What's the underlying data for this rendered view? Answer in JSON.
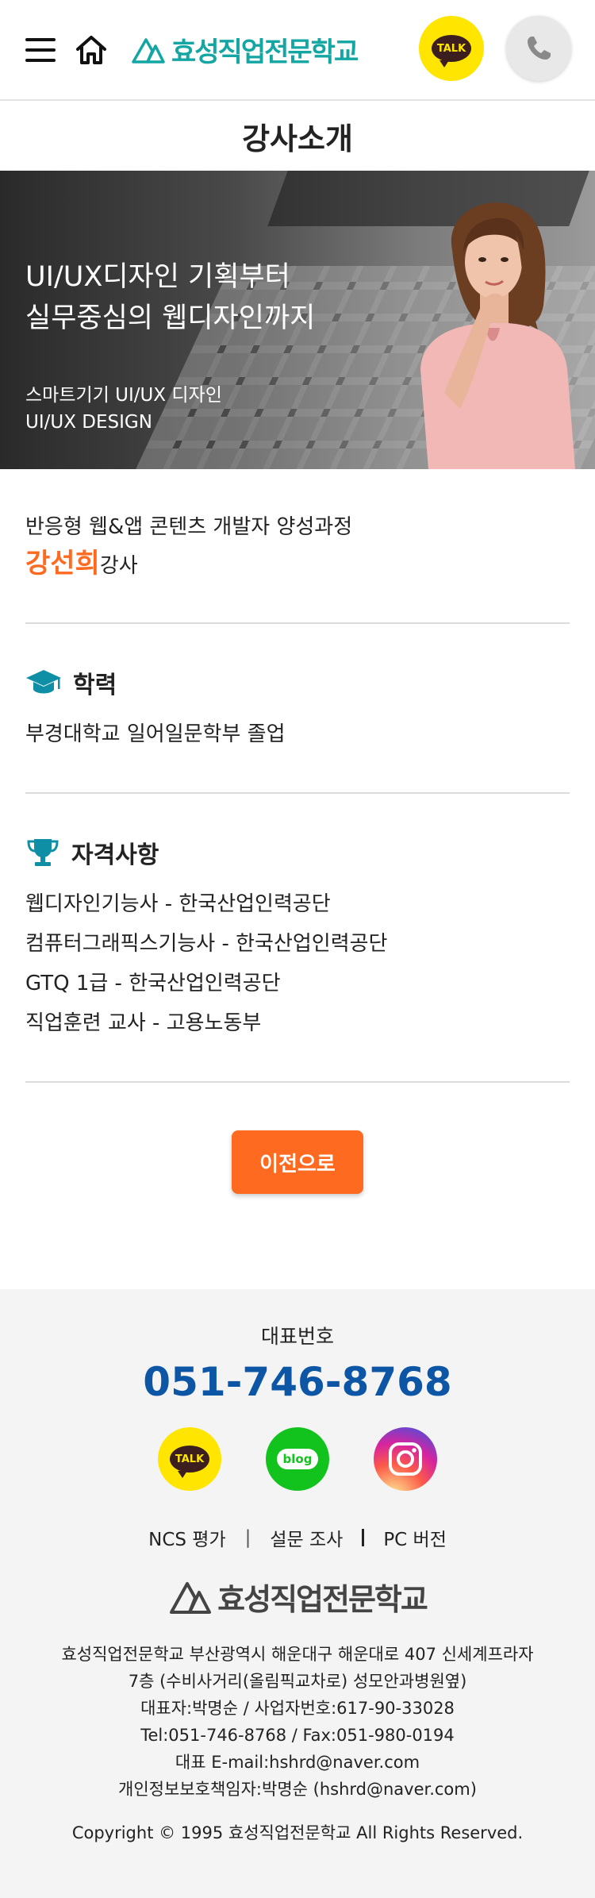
{
  "header": {
    "menu_icon": "hamburger-icon",
    "home_icon": "home-icon",
    "logo_text": "효성직업전문학교",
    "talk_label": "TALK",
    "phone_icon": "phone-icon"
  },
  "page_title": "강사소개",
  "hero": {
    "headline_line1": "UI/UX디자인 기획부터",
    "headline_line2": "실무중심의 웹디자인까지",
    "sub_line1": "스마트기기 UI/UX 디자인",
    "sub_line2": "UI/UX DESIGN"
  },
  "intro": {
    "course": "반응형 웹&앱 콘텐츠 개발자 양성과정",
    "name": "강선희",
    "title": "강사"
  },
  "education": {
    "title": "학력",
    "icon": "graduation-cap-icon",
    "items": [
      "부경대학교 일어일문학부 졸업"
    ]
  },
  "certifications": {
    "title": "자격사항",
    "icon": "trophy-icon",
    "items": [
      "웹디자인기능사 - 한국산업인력공단",
      "컴퓨터그래픽스기능사 - 한국산업인력공단",
      "GTQ 1급 - 한국산업인력공단",
      "직업훈련 교사 - 고용노동부"
    ]
  },
  "prev_button": "이전으로",
  "footer": {
    "rep_label": "대표번호",
    "rep_number": "051-746-8768",
    "social": {
      "talk_label": "TALK",
      "blog_label": "blog"
    },
    "links": [
      "NCS 평가",
      "설문 조사",
      "PC 버전"
    ],
    "logo_text": "효성직업전문학교",
    "info": [
      "효성직업전문학교 부산광역시 해운대구 해운대로 407 신세계프라자",
      "7층 (수비사거리(올림픽교차로) 성모안과병원옆)",
      "대표자:박명순 / 사업자번호:617-90-33028",
      "Tel:051-746-8768 / Fax:051-980-0194",
      "대표 E-mail:hshrd@naver.com",
      "개인정보보호책임자:박명순 (hshrd@naver.com)"
    ],
    "copyright": "Copyright © 1995 효성직업전문학교 All Rights Reserved."
  },
  "colors": {
    "accent_orange": "#ff6a21",
    "logo_teal": "#13a6a3",
    "phone_blue": "#0d56a6",
    "kakao_yellow": "#ffe500"
  }
}
